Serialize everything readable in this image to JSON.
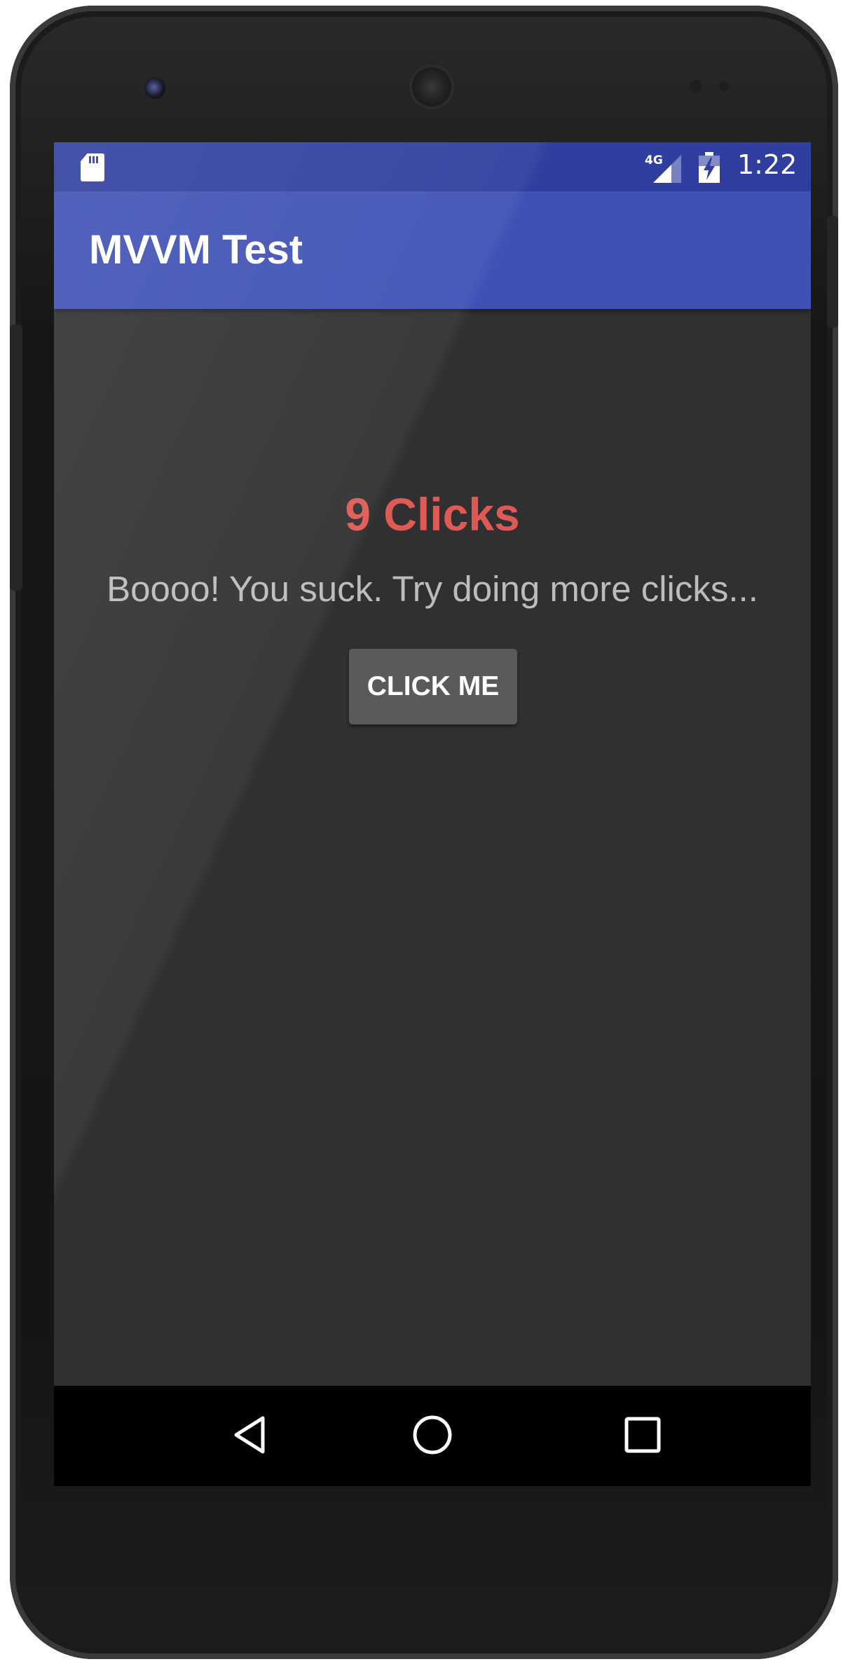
{
  "status_bar": {
    "network_type": "4G",
    "time": "1:22",
    "icons": [
      "sd-card-icon",
      "signal-icon",
      "battery-charging-icon"
    ]
  },
  "app_bar": {
    "title": "MVVM Test"
  },
  "main": {
    "clicks_text": "9 Clicks",
    "message": "Boooo! You suck. Try doing more clicks...",
    "button_label": "CLICK ME"
  },
  "nav_bar": {
    "buttons": [
      "back-icon",
      "home-icon",
      "recents-icon"
    ]
  },
  "colors": {
    "status_bar": "#303f9f",
    "app_bar": "#3f51b5",
    "background": "#303030",
    "clicks_text": "#e05a55",
    "message_text": "#bcbcbc",
    "button": "#5a5a5a"
  }
}
